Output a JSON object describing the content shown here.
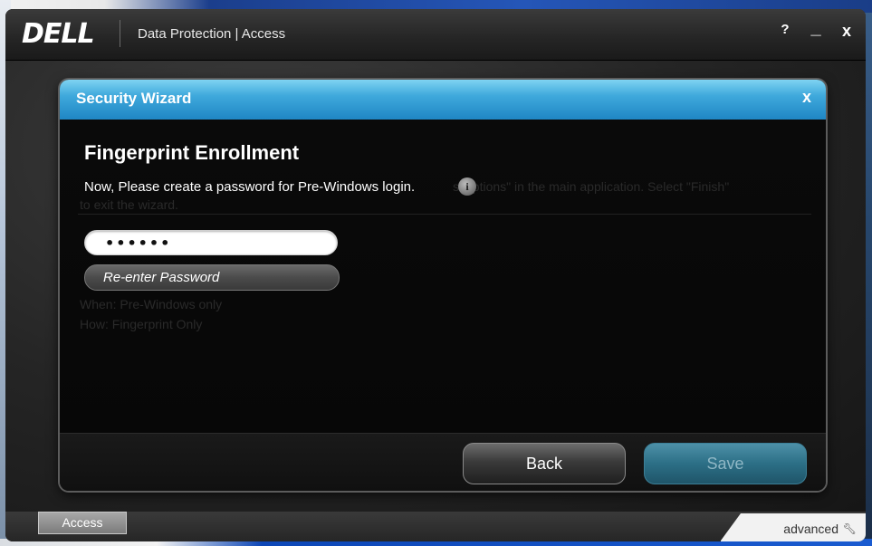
{
  "window": {
    "logo": "DELL",
    "title": "Data Protection | Access",
    "help_label": "?",
    "minimize_label": "_",
    "close_label": "x"
  },
  "wizard": {
    "title": "Security Wizard",
    "close_label": "x",
    "heading": "Fingerprint Enrollment",
    "instruction": "Now, Please create a password for Pre-Windows login.",
    "info_icon_label": "i",
    "password_value": "••••••",
    "reenter_placeholder": "Re-enter Password",
    "ghost": {
      "line1": "s Options\" in the main application. Select \"Finish\"",
      "line2": "to exit the wizard.",
      "line3": "When:   Pre-Windows only",
      "line4": "How:    Fingerprint Only"
    },
    "back_label": "Back",
    "save_label": "Save"
  },
  "bottom": {
    "access_tab": "Access",
    "advanced_label": "advanced",
    "advanced_icon": "wrench-icon"
  }
}
